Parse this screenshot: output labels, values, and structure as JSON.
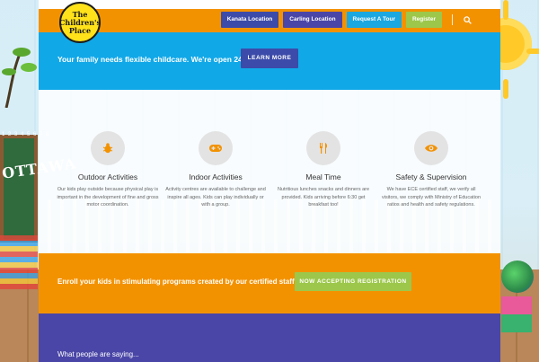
{
  "logo": {
    "line1": "The",
    "line2": "Children's",
    "line3": "Place"
  },
  "nav": {
    "items": [
      {
        "label": "Kanata Location"
      },
      {
        "label": "Carling Location"
      },
      {
        "label": "Request A Tour"
      },
      {
        "label": "Register"
      }
    ],
    "search_icon": "search-icon"
  },
  "hero": {
    "message": "Your family needs flexible childcare. We're open 24/7.",
    "button_label": "LEARN MORE"
  },
  "features": [
    {
      "icon": "bug-icon",
      "title": "Outdoor Activities",
      "text": "Our kids play outside because physical play is important in the development of fine and gross motor coordination."
    },
    {
      "icon": "gamepad-icon",
      "title": "Indoor Activities",
      "text": "Activity centres are available to challenge and inspire all ages. Kids can play individually or with a group."
    },
    {
      "icon": "cutlery-icon",
      "title": "Meal Time",
      "text": "Nutritious lunches snacks and dinners are provided. Kids arriving before 6:30 get breakfast too!"
    },
    {
      "icon": "eye-icon",
      "title": "Safety & Supervision",
      "text": "We have ECE certified staff, we verify all visitors, we comply with Ministry of Education ratios and health and safety regulations."
    }
  ],
  "enroll": {
    "message": "Enroll your kids in stimulating programs created by our certified staff.",
    "button_label": "NOW ACCEPTING REGISTRATION"
  },
  "testimonials": {
    "heading": "What people are saying..."
  },
  "background": {
    "chalkboard_text": "OTTAWA",
    "chalk_numbers": "1 2 3 4 5 6 7 8"
  },
  "colors": {
    "orange": "#f39200",
    "sky_blue": "#11a8e8",
    "navy": "#3c4ba9",
    "purple": "#4a46a7",
    "green": "#9cc74a",
    "icon_orange": "#f39200"
  }
}
